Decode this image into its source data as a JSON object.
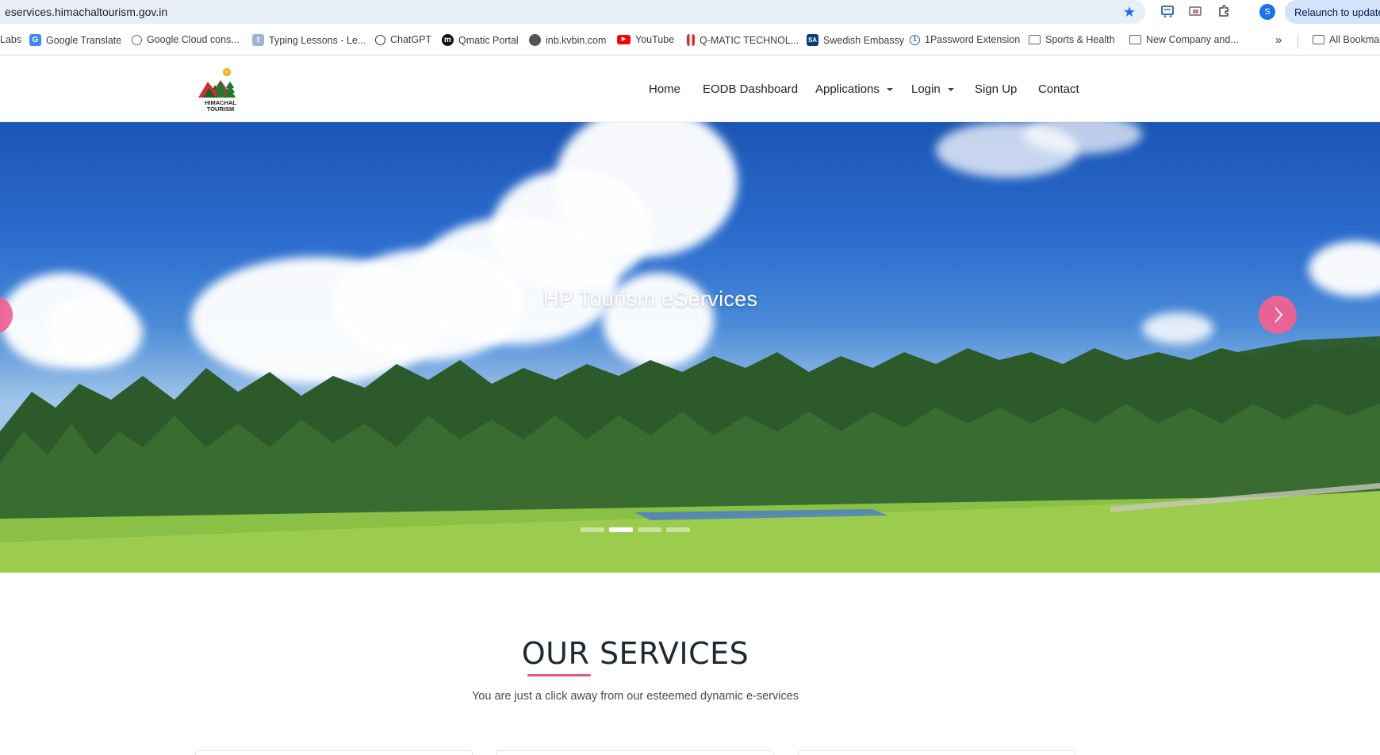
{
  "browser": {
    "url": "eservices.himachaltourism.gov.in",
    "relaunch_label": "Relaunch to update",
    "profile_initial": "S",
    "bookmarks": [
      {
        "label": "Labs",
        "icon": "none"
      },
      {
        "label": "Google Translate",
        "icon": "google-translate-icon"
      },
      {
        "label": "Google Cloud cons...",
        "icon": "google-cloud-icon"
      },
      {
        "label": "Typing Lessons - Le...",
        "icon": "typing-icon"
      },
      {
        "label": "ChatGPT",
        "icon": "chatgpt-icon"
      },
      {
        "label": "Qmatic Portal",
        "icon": "qmatic-icon"
      },
      {
        "label": "inb.kvbin.com",
        "icon": "globe-icon"
      },
      {
        "label": "YouTube",
        "icon": "youtube-icon"
      },
      {
        "label": "Q-MATIC TECHNOL...",
        "icon": "qmatic-bars-icon"
      },
      {
        "label": "Swedish Embassy",
        "icon": "sa-icon"
      },
      {
        "label": "1Password Extension",
        "icon": "onepassword-icon"
      },
      {
        "label": "Sports & Health",
        "icon": "folder-icon"
      },
      {
        "label": "New Company and...",
        "icon": "folder-icon"
      }
    ],
    "all_bookmarks_label": "All Bookma"
  },
  "site": {
    "logo_text_line1": "HIMACHAL",
    "logo_text_line2": "TOURISM",
    "nav": {
      "home": "Home",
      "eodb": "EODB Dashboard",
      "applications": "Applications",
      "login": "Login",
      "signup": "Sign Up",
      "contact": "Contact"
    }
  },
  "hero": {
    "title": "HP Tourism eServices",
    "slide_count": 4,
    "active_slide": 2
  },
  "services": {
    "title": "OUR SERVICES",
    "subtitle": "You are just a click away from our esteemed dynamic e-services"
  },
  "colors": {
    "accent_pink": "#f06292",
    "underline_pink": "#e2598b",
    "chrome_blue": "#1a73e8"
  }
}
